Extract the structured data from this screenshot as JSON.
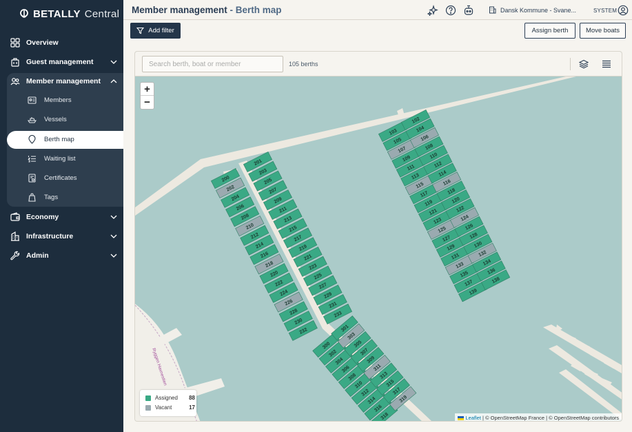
{
  "app": {
    "brand": "BETALLY",
    "product": "Central"
  },
  "sidebar": {
    "items": [
      {
        "id": "overview",
        "label": "Overview"
      },
      {
        "id": "guest",
        "label": "Guest management"
      },
      {
        "id": "member",
        "label": "Member management"
      },
      {
        "id": "economy",
        "label": "Economy"
      },
      {
        "id": "infrastructure",
        "label": "Infrastructure"
      },
      {
        "id": "admin",
        "label": "Admin"
      }
    ],
    "member_sub": [
      {
        "id": "members",
        "label": "Members"
      },
      {
        "id": "vessels",
        "label": "Vessels"
      },
      {
        "id": "berthmap",
        "label": "Berth map"
      },
      {
        "id": "waiting",
        "label": "Waiting list"
      },
      {
        "id": "certificates",
        "label": "Certificates"
      },
      {
        "id": "tags",
        "label": "Tags"
      }
    ]
  },
  "header": {
    "title_main": "Member management",
    "title_sep": " - ",
    "title_sub": "Berth map",
    "org": "Dansk Kommune - Svane...",
    "user": "SYSTEM"
  },
  "toolbar": {
    "add_filter": "Add filter",
    "assign_berth": "Assign berth",
    "move_boats": "Move boats"
  },
  "map": {
    "search_placeholder": "Search berth, boat or member",
    "berth_count": "105 berths",
    "zoom_in": "+",
    "zoom_out": "−",
    "legend": {
      "assigned_label": "Assigned",
      "assigned_count": "88",
      "assigned_color": "#3aa985",
      "vacant_label": "Vacant",
      "vacant_count": "17",
      "vacant_color": "#9aaab0"
    },
    "attribution": {
      "leaflet": "Leaflet",
      "rest": " | © OpenStreetMap France | © OpenStreetMap contributors"
    },
    "road_label": "Ryggen Havnestien",
    "colors": {
      "water": "#abcbc9",
      "land": "#f1efe9",
      "jetty": "#ede9e0"
    },
    "piers": [
      {
        "berths": [
          "200",
          "202",
          "204",
          "206",
          "208",
          "210",
          "212",
          "214",
          "216",
          "218",
          "220",
          "222",
          "224",
          "226",
          "228",
          "230",
          "232"
        ],
        "vacant": [
          "202",
          "210",
          "218",
          "226"
        ]
      },
      {
        "berths": [
          "201",
          "203",
          "205",
          "207",
          "209",
          "211",
          "213",
          "215",
          "217",
          "219",
          "221",
          "223",
          "225",
          "227",
          "229",
          "231",
          "233"
        ],
        "vacant": []
      },
      {
        "berths": [
          "300",
          "302",
          "304",
          "306",
          "308",
          "310",
          "312",
          "314",
          "316",
          "318"
        ],
        "vacant": []
      },
      {
        "berths": [
          "301",
          "303",
          "305",
          "307",
          "309",
          "311",
          "313",
          "315",
          "317",
          "319"
        ],
        "vacant": [
          "303",
          "311",
          "319"
        ]
      },
      {
        "berths": [
          "103",
          "105",
          "107",
          "109",
          "111",
          "113",
          "115",
          "117",
          "119",
          "121",
          "123",
          "125",
          "127",
          "129",
          "131",
          "133",
          "135",
          "137",
          "139"
        ],
        "vacant": [
          "107",
          "115",
          "125",
          "133"
        ]
      },
      {
        "berths": [
          "102",
          "104",
          "106",
          "108",
          "110",
          "112",
          "114",
          "116",
          "118",
          "120",
          "122",
          "124",
          "126",
          "128",
          "130",
          "132",
          "134",
          "136",
          "138"
        ],
        "vacant": [
          "106",
          "116",
          "124",
          "132"
        ]
      }
    ]
  }
}
